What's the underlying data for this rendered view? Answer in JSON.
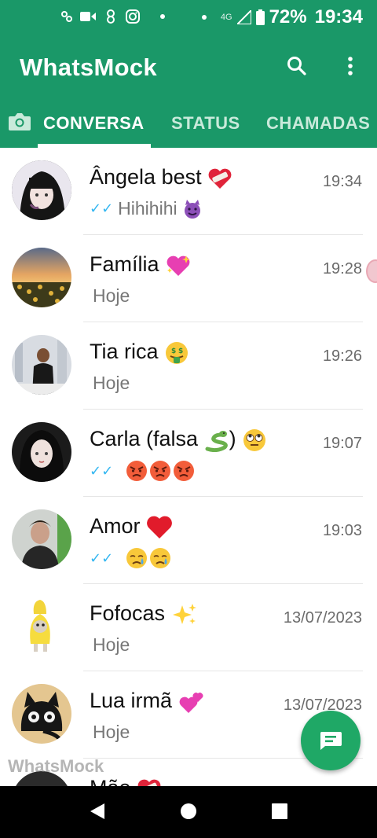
{
  "status_bar": {
    "battery": "72%",
    "time": "19:34",
    "network": "4G"
  },
  "app": {
    "title": "WhatsMock"
  },
  "tabs": [
    {
      "label": "CONVERSA",
      "active": true
    },
    {
      "label": "STATUS",
      "active": false
    },
    {
      "label": "CHAMADAS",
      "active": false
    }
  ],
  "chats": [
    {
      "name": "Ângela best",
      "time": "19:34",
      "preview": "Hihihihi",
      "read": true
    },
    {
      "name": "Família",
      "time": "19:28",
      "preview": "Hoje",
      "read": false
    },
    {
      "name": "Tia rica",
      "time": "19:26",
      "preview": "Hoje",
      "read": false
    },
    {
      "name": "Carla (falsa",
      "name_suffix": ")",
      "time": "19:07",
      "preview": "",
      "read": true
    },
    {
      "name": "Amor",
      "time": "19:03",
      "preview": "",
      "read": true
    },
    {
      "name": "Fofocas",
      "time": "13/07/2023",
      "preview": "Hoje",
      "read": false
    },
    {
      "name": "Lua irmã",
      "time": "13/07/2023",
      "preview": "Hoje",
      "read": false
    },
    {
      "name": "Mãe",
      "time": "",
      "preview": "",
      "read": false
    }
  ],
  "watermark": "WhatsMock",
  "colors": {
    "header": "#1a9868",
    "fab": "#1fa866",
    "read_ticks": "#34b7f1"
  },
  "icons": {
    "search": "search-icon",
    "menu": "more-vert-icon",
    "camera": "camera-icon",
    "fab": "new-chat-icon"
  }
}
